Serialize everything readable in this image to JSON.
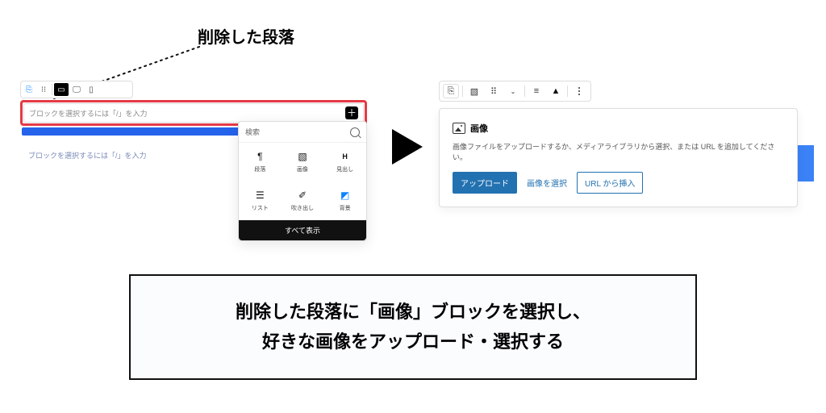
{
  "annotation": {
    "label": "削除した段落"
  },
  "left": {
    "placeholder": "ブロックを選択するには「/」を入力",
    "ghost_placeholder": "ブロックを選択するには「/」を入力",
    "inserter": {
      "search": "検索",
      "items": [
        {
          "label": "段落"
        },
        {
          "label": "画像"
        },
        {
          "label": "見出し"
        },
        {
          "label": "リスト"
        },
        {
          "label": "吹き出し"
        },
        {
          "label": "背景"
        }
      ],
      "footer": "すべて表示"
    }
  },
  "right": {
    "title": "画像",
    "description": "画像ファイルをアップロードするか、メディアライブラリから選択、または URL を追加してください。",
    "buttons": {
      "upload": "アップロード",
      "select": "画像を選択",
      "url": "URL から挿入"
    }
  },
  "callout": {
    "line1": "削除した段落に「画像」ブロックを選択し、",
    "line2": "好きな画像をアップロード・選択する"
  }
}
